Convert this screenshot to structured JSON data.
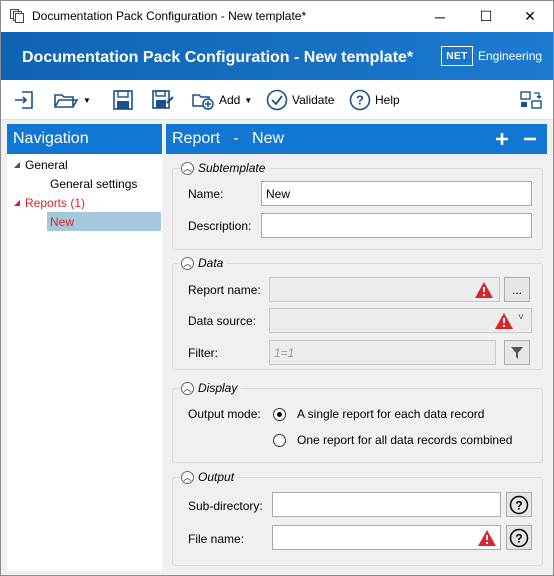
{
  "window": {
    "title": "Documentation Pack Configuration - New template*",
    "minimize": "─",
    "maximize": "☐",
    "close": "✕"
  },
  "header": {
    "title": "Documentation Pack Configuration - New template*",
    "brand_box": "NET",
    "brand_text": "Engineering"
  },
  "toolbar": {
    "add_label": "Add",
    "validate_label": "Validate",
    "help_label": "Help"
  },
  "navigation": {
    "title": "Navigation",
    "items": [
      {
        "label": "General"
      },
      {
        "label": "General settings"
      },
      {
        "label": "Reports (1)"
      },
      {
        "label": "New"
      }
    ]
  },
  "panel": {
    "title": "Report   -   New",
    "subtemplate": {
      "heading": "Subtemplate",
      "name_label": "Name:",
      "name_value": "New",
      "description_label": "Description:",
      "description_value": ""
    },
    "data": {
      "heading": "Data",
      "report_name_label": "Report name:",
      "browse_label": "...",
      "data_source_label": "Data source:",
      "filter_label": "Filter:",
      "filter_placeholder": "1=1"
    },
    "display": {
      "heading": "Display",
      "output_mode_label": "Output mode:",
      "options": [
        {
          "label": "A single report for each data record",
          "checked": true
        },
        {
          "label": "One report for all data records combined",
          "checked": false
        }
      ]
    },
    "output": {
      "heading": "Output",
      "subdir_label": "Sub-directory:",
      "subdir_value": "",
      "filename_label": "File name:",
      "filename_value": ""
    }
  },
  "colors": {
    "header_blue": "#1277d3",
    "error_red": "#d9262c",
    "selection": "#a6c8dc"
  }
}
